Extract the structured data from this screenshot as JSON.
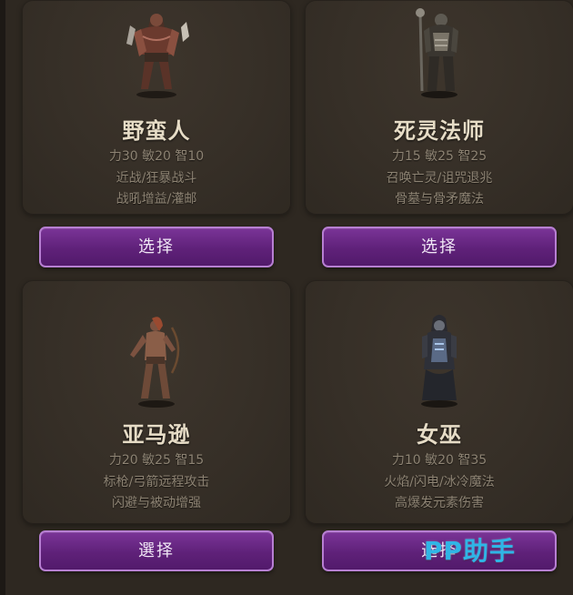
{
  "characters": [
    {
      "name": "野蛮人",
      "stats": "力30 敏20 智10",
      "trait_1": "近战/狂暴战斗",
      "trait_2": "战吼增益/灌邮",
      "button_label": "选择",
      "portrait_icon": "barbarian-portrait-icon"
    },
    {
      "name": "死灵法师",
      "stats": "力15 敏25 智25",
      "trait_1": "召唤亡灵/诅咒退兆",
      "trait_2": "骨墓与骨矛魔法",
      "button_label": "选择",
      "portrait_icon": "necromancer-portrait-icon"
    },
    {
      "name": "亚马逊",
      "stats": "力20 敏25 智15",
      "trait_1": "标枪/弓箭远程攻击",
      "trait_2": "闪避与被动增强",
      "button_label": "選择",
      "portrait_icon": "amazon-portrait-icon"
    },
    {
      "name": "女巫",
      "stats": "力10 敏20 智35",
      "trait_1": "火焰/闪电/冰冷魔法",
      "trait_2": "高爆发元素伤害",
      "button_label": "选择",
      "portrait_icon": "sorceress-portrait-icon"
    }
  ],
  "watermark": "PP助手",
  "colors": {
    "background": "#2e2821",
    "card": "#362f27",
    "button": "#5f2179",
    "button_border": "#b77fd2",
    "name_text": "#e6dcc6",
    "info_text": "#8d8373",
    "watermark": "#2fb5e6"
  }
}
